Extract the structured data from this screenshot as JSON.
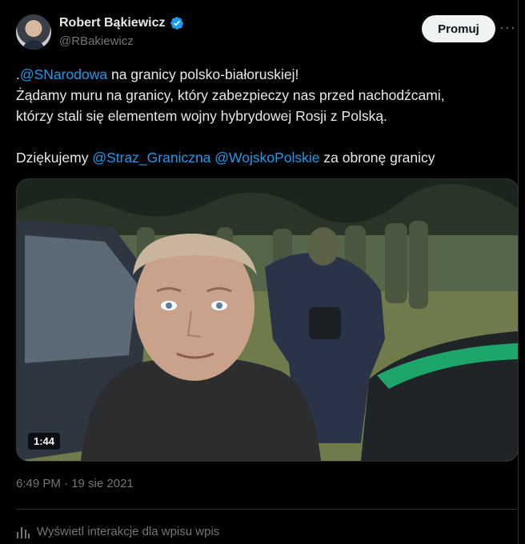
{
  "author": {
    "name": "Robert Bąkiewicz",
    "handle": "@RBakiewicz"
  },
  "actions": {
    "promote_label": "Promuj",
    "more_label": "···"
  },
  "tweet": {
    "line1_prefix": ".",
    "line1_mention": "@SNarodowa",
    "line1_rest": " na granicy polsko-białoruskiej!",
    "line2": "Żądamy muru na granicy, który zabezpieczy nas przed nachodźcami,",
    "line3": "którzy stali się elementem wojny hybrydowej Rosji z Polską.",
    "line4_prefix": "Dziękujemy ",
    "line4_mention1": "@Straz_Graniczna",
    "line4_space": " ",
    "line4_mention2": "@WojskoPolskie",
    "line4_rest": " za obronę granicy"
  },
  "media": {
    "video_duration": "1:44"
  },
  "meta": {
    "timestamp": "6:49 PM · 19 sie 2021",
    "analytics_label": "Wyświetl interakcje dla wpisu wpis"
  },
  "colors": {
    "accent": "#1d9bf0",
    "muted": "#71767b",
    "text": "#e7e9ea",
    "background": "#000000"
  }
}
